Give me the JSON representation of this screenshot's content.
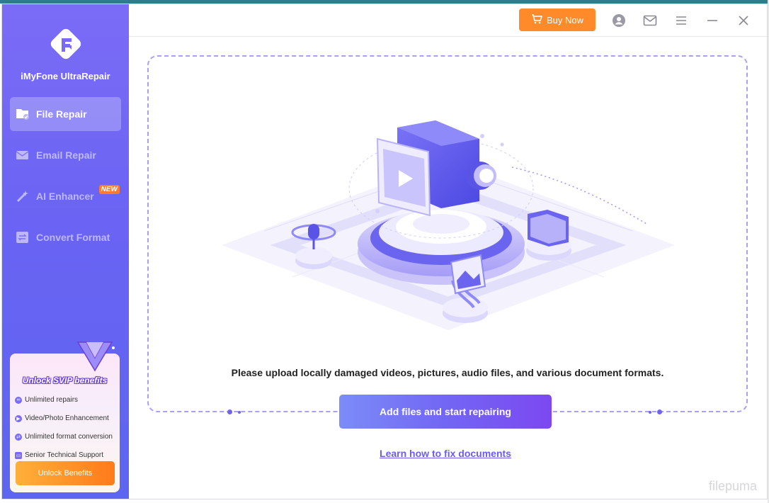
{
  "app": {
    "name": "iMyFone UltraRepair"
  },
  "header": {
    "buy_label": "Buy Now",
    "icons": [
      "account-icon",
      "mail-icon",
      "menu-icon",
      "minimize-icon",
      "close-icon"
    ]
  },
  "sidebar": {
    "items": [
      {
        "label": "File Repair",
        "icon": "file-repair-icon",
        "active": true
      },
      {
        "label": "Email Repair",
        "icon": "email-repair-icon",
        "active": false
      },
      {
        "label": "AI Enhancer",
        "icon": "ai-enhancer-icon",
        "active": false,
        "badge": "NEW"
      },
      {
        "label": "Convert Format",
        "icon": "convert-format-icon",
        "active": false
      }
    ]
  },
  "promo": {
    "title": "Unlock SVIP benefits",
    "benefits": [
      "Unlimited repairs",
      "Video/Photo Enhancement",
      "Unlimited format conversion",
      "Senior Technical Support"
    ],
    "button_label": "Unlock Benefits"
  },
  "main": {
    "upload_text": "Please upload locally damaged videos, pictures, audio files, and various document formats.",
    "add_button_label": "Add files and start repairing",
    "learn_link": "Learn how to fix documents"
  },
  "watermark": "filepuma",
  "colors": {
    "sidebar_top": "#7b6cf6",
    "accent": "#6a5cf0",
    "buy_button": "#ff8a2a"
  }
}
